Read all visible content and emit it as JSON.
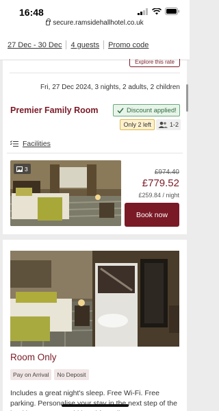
{
  "status": {
    "time": "16:48"
  },
  "browser": {
    "url": "secure.ramsidehallhotel.co.uk"
  },
  "search": {
    "dates": "27 Dec - 30 Dec",
    "guests": "4 guests",
    "promo": "Promo code"
  },
  "explore_rate": "Explore this rate",
  "stay": {
    "details": "Fri, 27 Dec 2024, 3 nights, 2 adults, 2 children"
  },
  "room": {
    "title": "Premier Family Room",
    "discount": "Discount applied!",
    "availability": "Only 2 left",
    "occupancy": "1-2",
    "facilities": "Facilities",
    "photo_count": "3",
    "price_old": "£974.40",
    "price_new": "£779.52",
    "price_night": "£259.84 / night",
    "book": "Book now"
  },
  "rate": {
    "title": "Room Only",
    "tags": [
      "Pay on Arrival",
      "No Deposit"
    ],
    "description": "Includes a great night's sleep. Free Wi-Fi. Free parking. Personalise your stay in the next step of the booking process. Add breakfast, dinner..."
  },
  "colors": {
    "brand": "#7a1a26",
    "discount_bg": "#e8f4ea",
    "warning_bg": "#fdf1cd"
  },
  "icons": [
    "wifi-icon",
    "signal-icon",
    "battery-icon",
    "lock-icon",
    "check-icon",
    "person-icon",
    "list-icon",
    "image-icon"
  ]
}
